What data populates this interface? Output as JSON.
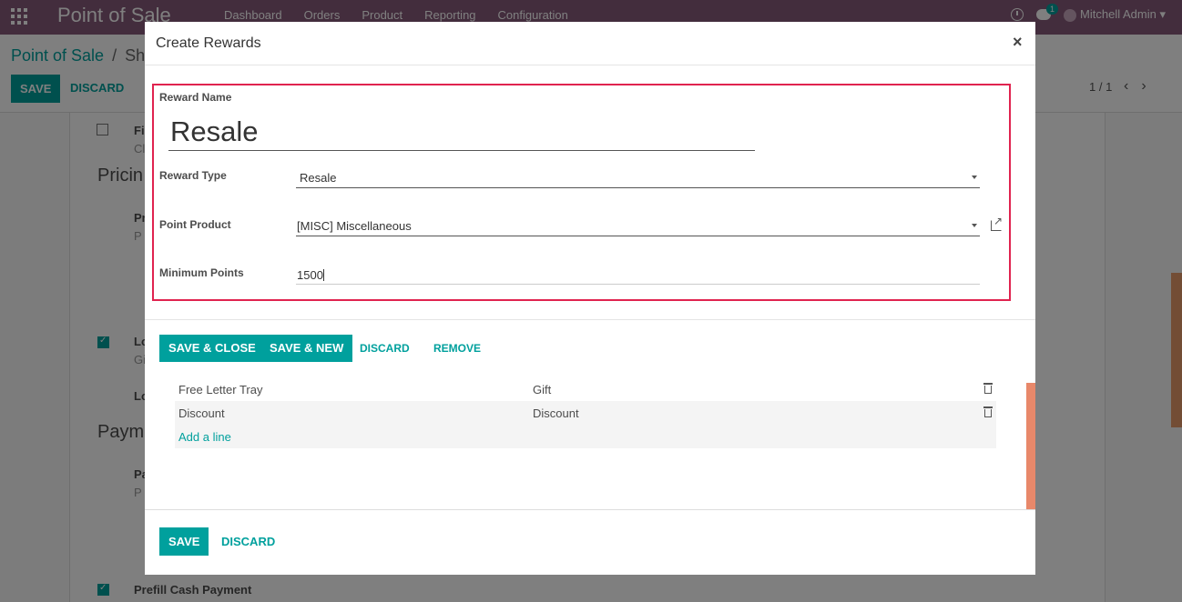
{
  "app": {
    "name": "Point of Sale",
    "menu": [
      "Dashboard",
      "Orders",
      "Product",
      "Reporting",
      "Configuration"
    ],
    "chat_badge": "1",
    "user": "Mitchell Admin"
  },
  "control_panel": {
    "breadcrumb_root": "Point of Sale",
    "breadcrumb_sep": "/",
    "breadcrumb_current": "Sho",
    "save_label": "SAVE",
    "discard_label": "DISCARD",
    "pager": "1 / 1"
  },
  "background_form": {
    "pricing_heading": "Pricin",
    "payment_heading": "Payme",
    "prefill_label": "Prefill Cash Payment",
    "fragments": [
      "Fi",
      "Cl",
      "Pr",
      "P",
      "Lo",
      "Gi",
      "Lo",
      "Pa",
      "P"
    ]
  },
  "rewards_list": {
    "rows": [
      {
        "name": "Free Letter Tray",
        "type": "Gift"
      },
      {
        "name": "Discount",
        "type": "Discount"
      }
    ],
    "add_line": "Add a line",
    "save_label": "SAVE",
    "discard_label": "DISCARD"
  },
  "modal": {
    "title": "Create Rewards",
    "close": "×",
    "reward_name_label": "Reward Name",
    "reward_name_value": "Resale",
    "reward_type_label": "Reward Type",
    "reward_type_value": "Resale",
    "point_product_label": "Point Product",
    "point_product_value": "[MISC] Miscellaneous",
    "minimum_points_label": "Minimum Points",
    "minimum_points_value": "1500",
    "buttons": {
      "save_close": "SAVE & CLOSE",
      "save_new": "SAVE & NEW",
      "discard": "DISCARD",
      "remove": "REMOVE"
    }
  },
  "colors": {
    "brand": "#875a7b",
    "accent": "#00a09d",
    "highlight": "#e0234f"
  }
}
